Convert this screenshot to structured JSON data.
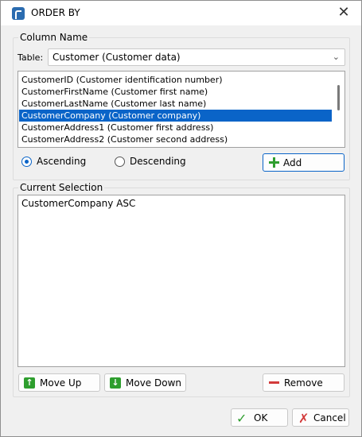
{
  "window": {
    "title": "ORDER BY",
    "close_glyph": "✕"
  },
  "column_group": {
    "legend": "Column Name",
    "table_label": "Table:",
    "table_value": "Customer  (Customer data)",
    "columns": [
      "CustomerID  (Customer identification number)",
      "CustomerFirstName  (Customer first name)",
      "CustomerLastName  (Customer last name)",
      "CustomerCompany  (Customer company)",
      "CustomerAddress1  (Customer first address)",
      "CustomerAddress2  (Customer second address)"
    ],
    "selected_index": 3,
    "ascending_label": "Ascending",
    "descending_label": "Descending",
    "sort_selected": "Ascending",
    "add_label": "Add"
  },
  "selection_group": {
    "legend": "Current Selection",
    "items": [
      "CustomerCompany ASC"
    ],
    "move_up_label": "Move Up",
    "move_down_label": "Move Down",
    "remove_label": "Remove"
  },
  "footer": {
    "ok_label": "OK",
    "cancel_label": "Cancel"
  },
  "colors": {
    "accent": "#0a64c8",
    "green": "#2e9e2e",
    "red": "#d23a3a"
  },
  "icons": [
    "app-icon",
    "close-icon",
    "chevron-down-icon",
    "plus-icon",
    "arrow-up-icon",
    "arrow-down-icon",
    "minus-icon",
    "check-icon",
    "cross-icon"
  ]
}
